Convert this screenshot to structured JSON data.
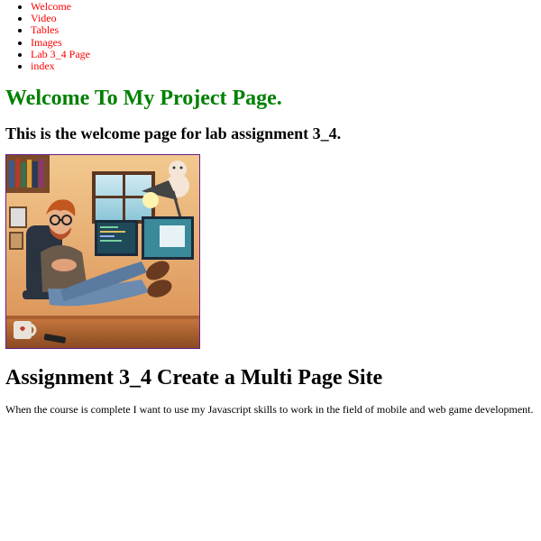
{
  "nav": {
    "items": [
      {
        "label": "Welcome"
      },
      {
        "label": "Video"
      },
      {
        "label": "Tables"
      },
      {
        "label": "Images"
      },
      {
        "label": "Lab 3_4 Page"
      },
      {
        "label": "index"
      }
    ],
    "link_color": "#ff0000"
  },
  "header": {
    "title": "Welcome To My Project Page.",
    "title_color": "#008000",
    "subtitle": "This is the welcome page for lab assignment 3_4."
  },
  "main": {
    "section_title": "Assignment 3_4 Create a Multi Page Site",
    "paragraph": "When the course is complete I want to use my Javascript skills to work in the field of mobile and web game development."
  }
}
